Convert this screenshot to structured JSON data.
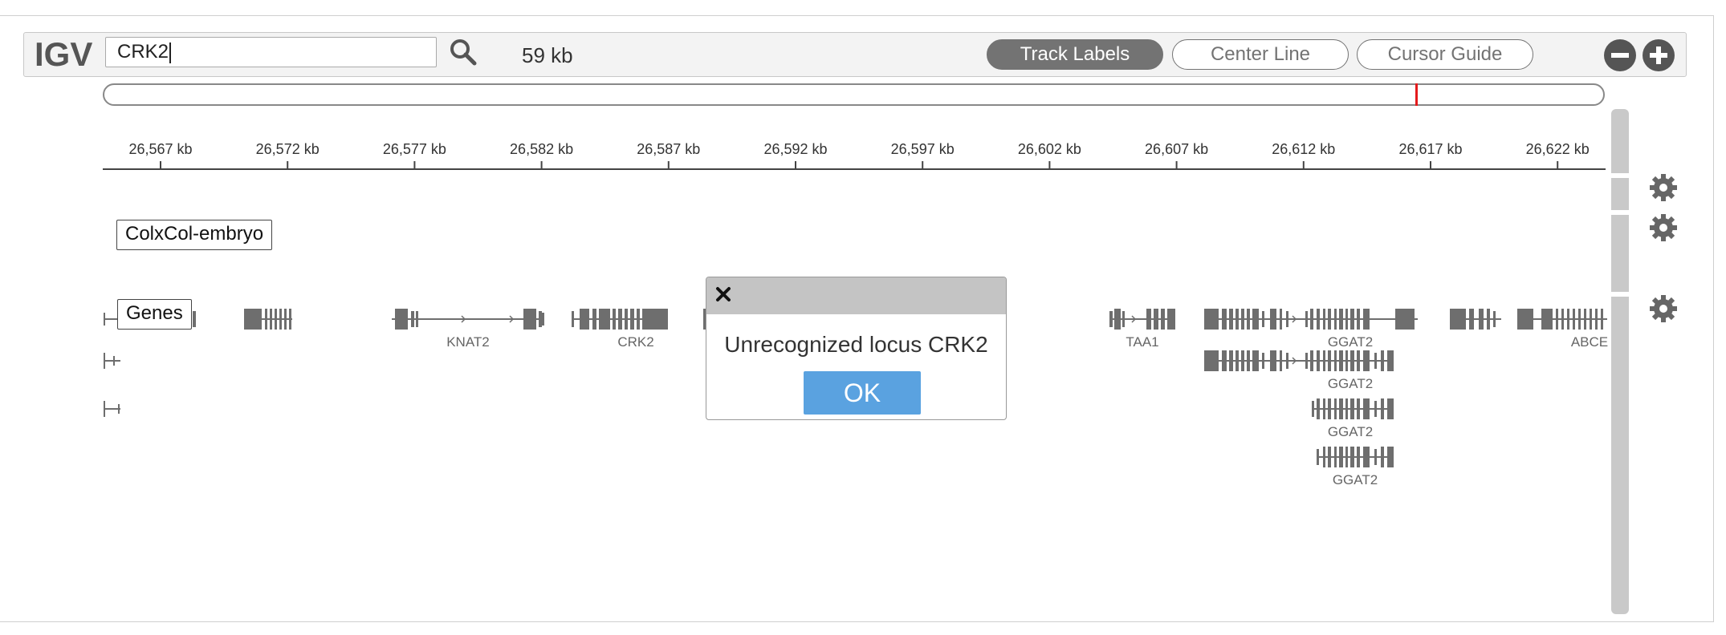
{
  "app": {
    "logo": "IGV"
  },
  "search": {
    "value": "CRK2"
  },
  "window_size": "59 kb",
  "toggles": {
    "track_labels": "Track Labels",
    "center_line": "Center Line",
    "cursor_guide": "Cursor Guide"
  },
  "zoom": {
    "out_icon": "minus-circle-icon",
    "in_icon": "plus-circle-icon"
  },
  "ruler": {
    "ticks": [
      "26,567 kb",
      "26,572 kb",
      "26,577 kb",
      "26,582 kb",
      "26,587 kb",
      "26,592 kb",
      "26,597 kb",
      "26,602 kb",
      "26,607 kb",
      "26,612 kb",
      "26,617 kb",
      "26,622 kb"
    ]
  },
  "tracks": {
    "alignment": {
      "label": "ColxCol-embryo"
    },
    "genes": {
      "label": "Genes",
      "gene_labels": [
        "KNAT2",
        "CRK2",
        "TAA1",
        "GGAT2",
        "ABCE",
        "GGAT2",
        "GGAT2",
        "GGAT2"
      ]
    }
  },
  "dialog": {
    "message": "Unrecognized locus CRK2",
    "ok_label": "OK",
    "close_icon": "close-icon"
  },
  "colors": {
    "accent": "#737373",
    "ok_button": "#5aa2e0",
    "ideogram_marker": "#e41a1c",
    "gene_feature": "#6e6e6e"
  }
}
